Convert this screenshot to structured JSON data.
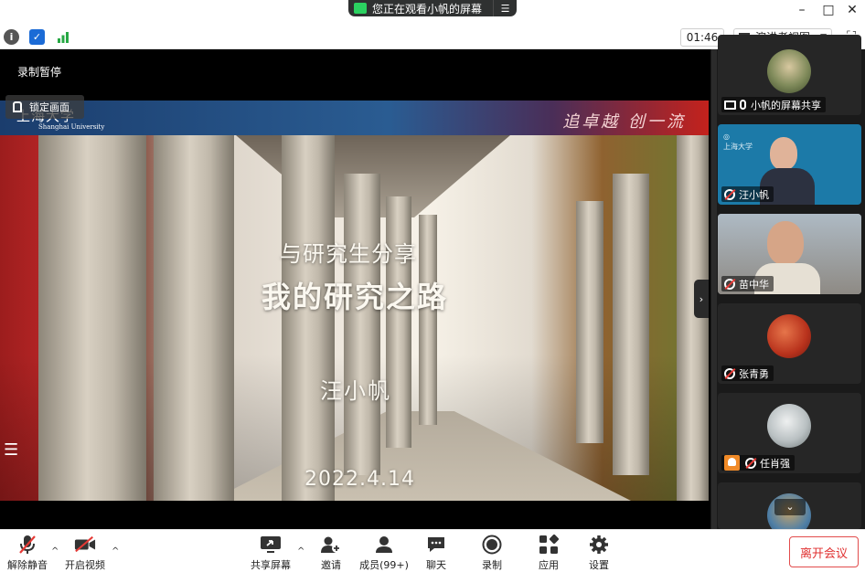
{
  "titlebar": {
    "share_banner_text": "您正在观看小帆的屏幕",
    "minimize": "–",
    "maximize": "□",
    "close": "✕"
  },
  "infobar": {
    "timer": "01:46",
    "view_label": "演讲者视图"
  },
  "main": {
    "recording_label": "录制暂停",
    "lock_screen_label": "锁定画面",
    "slide": {
      "university_cn": "上海大学",
      "university_en": "Shanghai University",
      "motto": "追卓越 创一流",
      "subtitle": "与研究生分享",
      "title": "我的研究之路",
      "speaker": "汪小帆",
      "date": "2022.4.14"
    }
  },
  "participants": [
    {
      "name": "小帆的屏幕共享",
      "state": "sharing"
    },
    {
      "name": "汪小帆",
      "state": "speaking"
    },
    {
      "name": "苗中华",
      "state": "muted"
    },
    {
      "name": "张青勇",
      "state": "muted"
    },
    {
      "name": "任肖强",
      "state": "muted"
    },
    {
      "name": "",
      "state": "muted"
    }
  ],
  "toolbar": {
    "unmute": "解除静音",
    "start_video": "开启视频",
    "share_screen": "共享屏幕",
    "invite": "邀请",
    "members": "成员(99+)",
    "chat": "聊天",
    "record": "录制",
    "apps": "应用",
    "settings": "设置",
    "leave": "离开会议"
  },
  "colors": {
    "accent_active_tile": "#1c7aa8",
    "leave_red": "#e03131",
    "banner_green": "#2bd160"
  }
}
